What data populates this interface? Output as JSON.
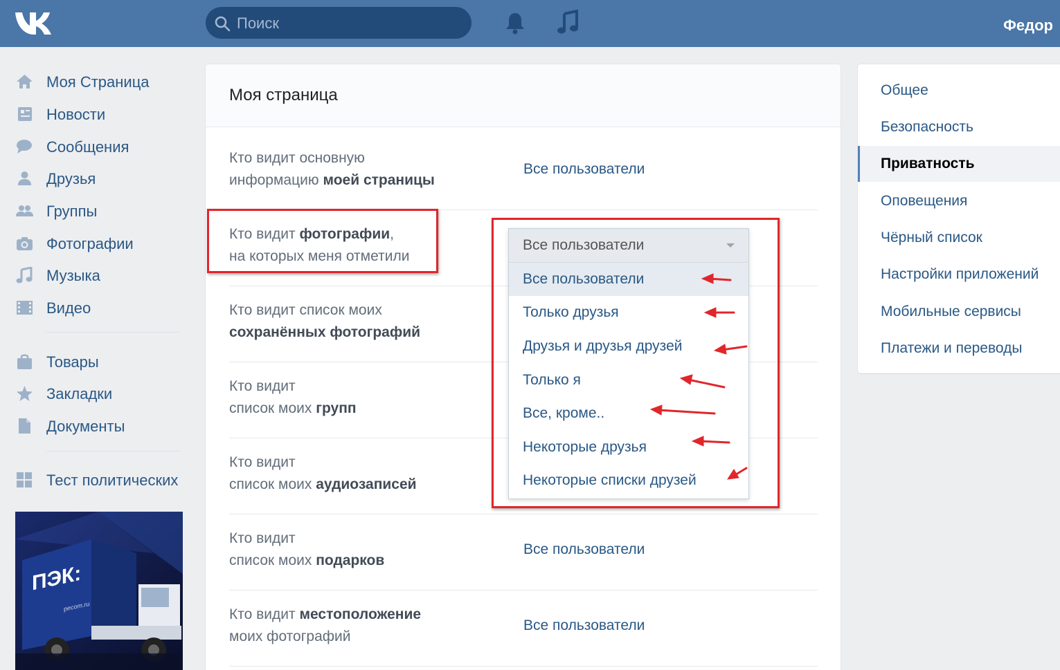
{
  "header": {
    "logo_icon": "vk-logo-icon",
    "search_placeholder": "Поиск",
    "username": "Федор",
    "accent_color": "#4a76a8"
  },
  "left_nav": {
    "items": [
      {
        "label": "Моя Страница",
        "icon": "home-icon"
      },
      {
        "label": "Новости",
        "icon": "news-icon"
      },
      {
        "label": "Сообщения",
        "icon": "messages-icon"
      },
      {
        "label": "Друзья",
        "icon": "friends-icon"
      },
      {
        "label": "Группы",
        "icon": "groups-icon"
      },
      {
        "label": "Фотографии",
        "icon": "camera-icon"
      },
      {
        "label": "Музыка",
        "icon": "music-icon"
      },
      {
        "label": "Видео",
        "icon": "video-icon"
      },
      {
        "label": "Товары",
        "icon": "bag-icon"
      },
      {
        "label": "Закладки",
        "icon": "star-icon"
      },
      {
        "label": "Документы",
        "icon": "document-icon"
      },
      {
        "label": "Тест политических",
        "icon": "apps-icon"
      }
    ],
    "ad": {
      "brand": "ПЭК:",
      "site": "pecom.ru"
    }
  },
  "main": {
    "title": "Моя страница",
    "rows": [
      {
        "q1": "Кто видит основную",
        "q2a": "информацию ",
        "q2b": "моей страницы",
        "value": "Все пользователи"
      },
      {
        "q1a": "Кто видит ",
        "q1b": "фотографии",
        "q1c": ",",
        "q2": "на которых меня отметили"
      },
      {
        "q1": "Кто видит список моих",
        "q2b": "сохранённых фотографий"
      },
      {
        "q1": "Кто видит",
        "q2a": "список моих ",
        "q2b": "групп"
      },
      {
        "q1": "Кто видит",
        "q2a": "список моих ",
        "q2b": "аудиозаписей"
      },
      {
        "q1": "Кто видит",
        "q2a": "список моих ",
        "q2b": "подарков",
        "value": "Все пользователи"
      },
      {
        "q1a": "Кто видит ",
        "q1b": "местоположение",
        "q2": "моих фотографий",
        "value": "Все пользователи"
      }
    ],
    "dropdown": {
      "selected": "Все пользователи",
      "options": [
        "Все пользователи",
        "Только друзья",
        "Друзья и друзья друзей",
        "Только я",
        "Все, кроме..",
        "Некоторые друзья",
        "Некоторые списки друзей"
      ]
    }
  },
  "right_nav": {
    "items": [
      "Общее",
      "Безопасность",
      "Приватность",
      "Оповещения",
      "Чёрный список",
      "Настройки приложений",
      "Мобильные сервисы",
      "Платежи и переводы"
    ],
    "active": "Приватность"
  },
  "annotation_color": "#e0262a"
}
